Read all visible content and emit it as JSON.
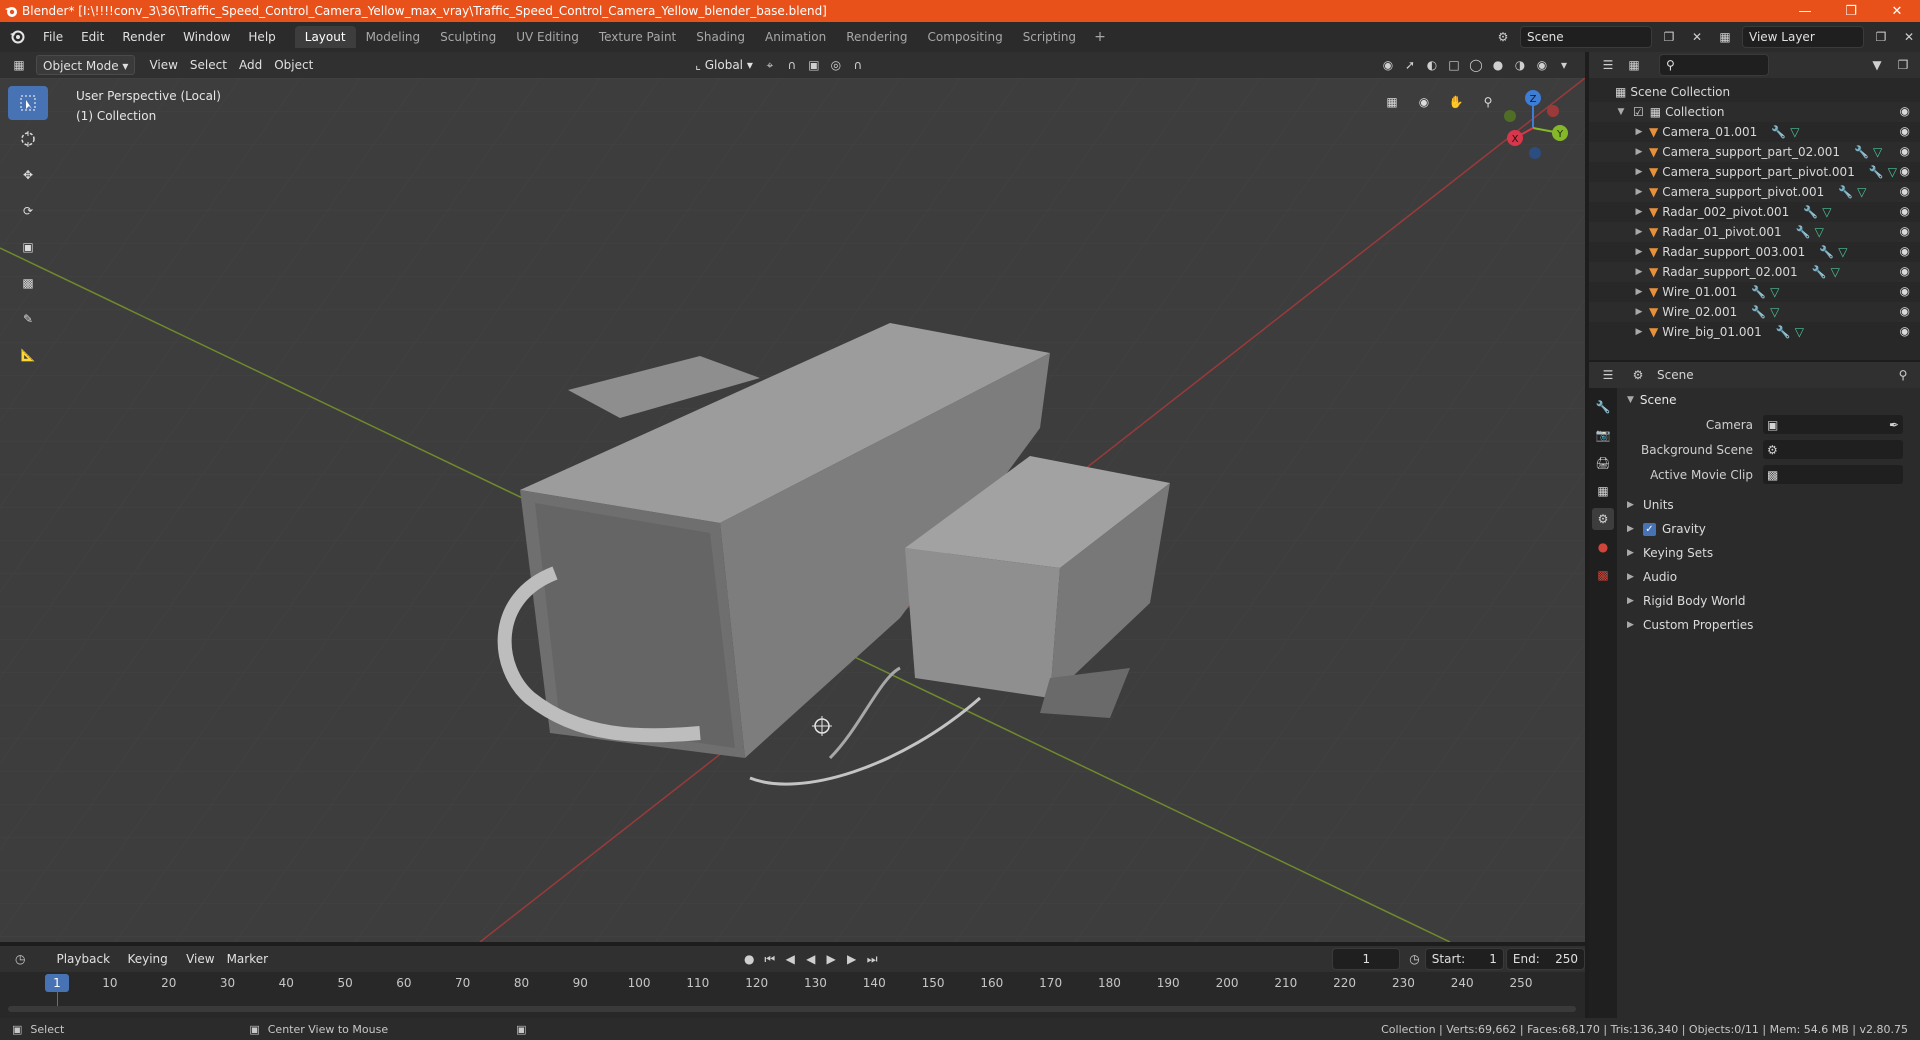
{
  "window": {
    "title": "Blender* [I:\\!!!!conv_3\\36\\Traffic_Speed_Control_Camera_Yellow_max_vray\\Traffic_Speed_Control_Camera_Yellow_blender_base.blend]",
    "accent": "#e8521a"
  },
  "menu": {
    "items": [
      "File",
      "Edit",
      "Render",
      "Window",
      "Help"
    ],
    "workspaces": [
      "Layout",
      "Modeling",
      "Sculpting",
      "UV Editing",
      "Texture Paint",
      "Shading",
      "Animation",
      "Rendering",
      "Compositing",
      "Scripting"
    ],
    "active_workspace": "Layout",
    "add_workspace": "+",
    "scene": "Scene",
    "view_layer": "View Layer"
  },
  "viewport_header": {
    "mode": "Object Mode",
    "menus": [
      "View",
      "Select",
      "Add",
      "Object"
    ],
    "transform_orientation": "Global"
  },
  "viewport": {
    "perspective_label": "User Perspective (Local)",
    "collection_label": "(1) Collection",
    "gizmo_axes": [
      "X",
      "Y",
      "Z"
    ],
    "tools": [
      "select-box-icon",
      "cursor-icon",
      "move-icon",
      "rotate-icon",
      "scale-icon",
      "transform-icon",
      "annotate-icon",
      "measure-icon"
    ]
  },
  "outliner": {
    "root": "Scene Collection",
    "collection": "Collection",
    "objects": [
      "Camera_01.001",
      "Camera_support_part_02.001",
      "Camera_support_part_pivot.001",
      "Camera_support_pivot.001",
      "Radar_002_pivot.001",
      "Radar_01_pivot.001",
      "Radar_support_003.001",
      "Radar_support_02.001",
      "Wire_01.001",
      "Wire_02.001",
      "Wire_big_01.001"
    ]
  },
  "properties": {
    "context": "Scene",
    "panel": "Scene",
    "fields": [
      {
        "label": "Camera",
        "value": ""
      },
      {
        "label": "Background Scene",
        "value": ""
      },
      {
        "label": "Active Movie Clip",
        "value": ""
      }
    ],
    "subpanels": [
      "Units",
      "Gravity",
      "Keying Sets",
      "Audio",
      "Rigid Body World",
      "Custom Properties"
    ],
    "gravity_enabled": true
  },
  "timeline": {
    "menus": [
      "Playback",
      "Keying",
      "View",
      "Marker"
    ],
    "current_frame": "1",
    "start_label": "Start:",
    "start": "1",
    "end_label": "End:",
    "end": "250",
    "ticks": [
      "10",
      "20",
      "30",
      "40",
      "50",
      "60",
      "70",
      "80",
      "90",
      "100",
      "110",
      "120",
      "130",
      "140",
      "150",
      "160",
      "170",
      "180",
      "190",
      "200",
      "210",
      "220",
      "230",
      "240",
      "250"
    ]
  },
  "statusbar": {
    "select": "Select",
    "center_view": "Center View to Mouse",
    "stats": "Collection | Verts:69,662 | Faces:68,170 | Tris:136,340 | Objects:0/11 | Mem: 54.6 MB | v2.80.75"
  }
}
